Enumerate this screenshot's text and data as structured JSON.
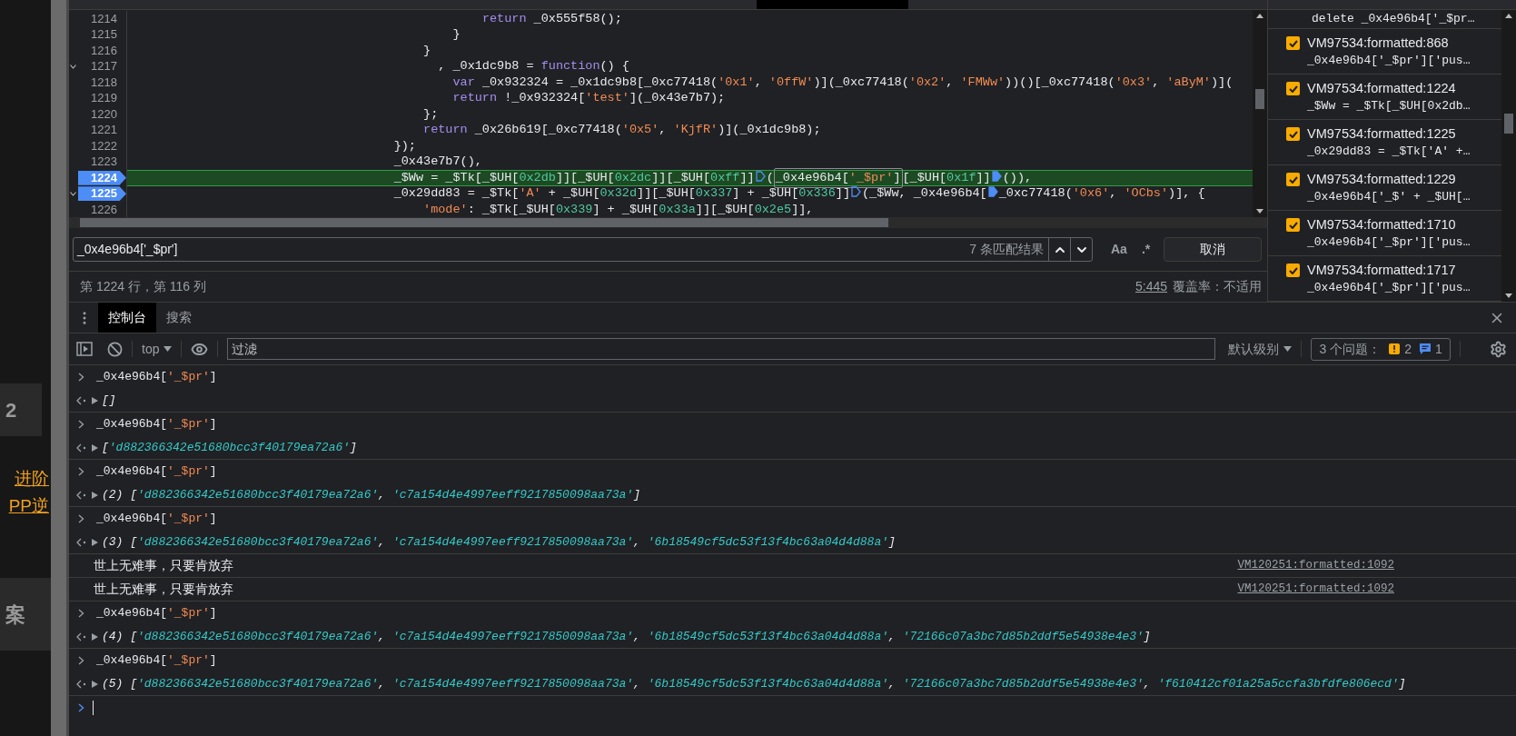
{
  "background_page": {
    "fragments": [
      {
        "text": "2",
        "kind": "tile"
      },
      {
        "text": "进阶",
        "kind": "link"
      },
      {
        "text": "PP逆",
        "kind": "link"
      },
      {
        "text": "案",
        "kind": "tile"
      }
    ]
  },
  "editor": {
    "lines": [
      {
        "number": "1214",
        "fold": false,
        "breakpoint": false,
        "current": false,
        "tokens": [
          {
            "t": "                                                return",
            "kind": "keyword"
          },
          {
            "t": " _0x555f58();",
            "kind": "plain"
          }
        ]
      },
      {
        "number": "1215",
        "fold": false,
        "breakpoint": false,
        "current": false,
        "tokens": [
          {
            "t": "                                            }",
            "kind": "plain"
          }
        ]
      },
      {
        "number": "1216",
        "fold": false,
        "breakpoint": false,
        "current": false,
        "tokens": [
          {
            "t": "                                        }",
            "kind": "plain"
          }
        ]
      },
      {
        "number": "1217",
        "fold": true,
        "breakpoint": false,
        "current": false,
        "tokens": [
          {
            "t": "                                          , _0x1dc9b8 = ",
            "kind": "plain"
          },
          {
            "t": "function",
            "kind": "keyword"
          },
          {
            "t": "() {",
            "kind": "plain"
          }
        ]
      },
      {
        "number": "1218",
        "fold": false,
        "breakpoint": false,
        "current": false,
        "tokens": [
          {
            "t": "                                            var",
            "kind": "keyword"
          },
          {
            "t": " _0x932324 = _0x1dc9b8[_0xc77418(",
            "kind": "plain"
          },
          {
            "t": "'0x1'",
            "kind": "string"
          },
          {
            "t": ", ",
            "kind": "plain"
          },
          {
            "t": "'0ffW'",
            "kind": "string"
          },
          {
            "t": ")](_0xc77418(",
            "kind": "plain"
          },
          {
            "t": "'0x2'",
            "kind": "string"
          },
          {
            "t": ", ",
            "kind": "plain"
          },
          {
            "t": "'FMWw'",
            "kind": "string"
          },
          {
            "t": "))()[_0xc77418(",
            "kind": "plain"
          },
          {
            "t": "'0x3'",
            "kind": "string"
          },
          {
            "t": ", ",
            "kind": "plain"
          },
          {
            "t": "'aByM'",
            "kind": "string"
          },
          {
            "t": ")](",
            "kind": "plain"
          }
        ]
      },
      {
        "number": "1219",
        "fold": false,
        "breakpoint": false,
        "current": false,
        "tokens": [
          {
            "t": "                                            return",
            "kind": "keyword"
          },
          {
            "t": " !_0x932324[",
            "kind": "plain"
          },
          {
            "t": "'test'",
            "kind": "string"
          },
          {
            "t": "](_0x43e7b7);",
            "kind": "plain"
          }
        ]
      },
      {
        "number": "1220",
        "fold": false,
        "breakpoint": false,
        "current": false,
        "tokens": [
          {
            "t": "                                        };",
            "kind": "plain"
          }
        ]
      },
      {
        "number": "1221",
        "fold": false,
        "breakpoint": false,
        "current": false,
        "tokens": [
          {
            "t": "                                        return",
            "kind": "keyword"
          },
          {
            "t": " _0x26b619[_0xc77418(",
            "kind": "plain"
          },
          {
            "t": "'0x5'",
            "kind": "string"
          },
          {
            "t": ", ",
            "kind": "plain"
          },
          {
            "t": "'KjfR'",
            "kind": "string"
          },
          {
            "t": ")](_0x1dc9b8);",
            "kind": "plain"
          }
        ]
      },
      {
        "number": "1222",
        "fold": false,
        "breakpoint": false,
        "current": false,
        "tokens": [
          {
            "t": "                                    });",
            "kind": "plain"
          }
        ]
      },
      {
        "number": "1223",
        "fold": false,
        "breakpoint": false,
        "current": false,
        "tokens": [
          {
            "t": "                                    _0x43e7b7(),",
            "kind": "plain"
          }
        ]
      },
      {
        "number": "1224",
        "fold": false,
        "breakpoint": true,
        "current": true,
        "tokens": [
          {
            "t": "                                    _$Ww = _$Tk[_$UH[",
            "kind": "plain"
          },
          {
            "t": "0x2db",
            "kind": "number"
          },
          {
            "t": "]][_$UH[",
            "kind": "plain"
          },
          {
            "t": "0x2dc",
            "kind": "number"
          },
          {
            "t": "]][_$UH[",
            "kind": "plain"
          },
          {
            "t": "0xff",
            "kind": "number"
          },
          {
            "t": "]]",
            "kind": "plain"
          },
          {
            "kind": "marker",
            "active": false
          },
          {
            "t": "(",
            "kind": "plain"
          },
          {
            "kind": "match",
            "parts": [
              {
                "t": "_0x4e96b4[",
                "kind": "plain"
              },
              {
                "t": "'_$pr'",
                "kind": "string"
              },
              {
                "t": "]",
                "kind": "plain"
              }
            ]
          },
          {
            "t": "[_$UH[",
            "kind": "plain"
          },
          {
            "t": "0x1f",
            "kind": "number"
          },
          {
            "t": "]]",
            "kind": "plain"
          },
          {
            "kind": "marker",
            "active": true
          },
          {
            "t": "()),",
            "kind": "plain"
          }
        ]
      },
      {
        "number": "1225",
        "fold": true,
        "breakpoint": true,
        "current": false,
        "tokens": [
          {
            "t": "                                    _0x29dd83 = _$Tk[",
            "kind": "plain"
          },
          {
            "t": "'A'",
            "kind": "string"
          },
          {
            "t": " + _$UH[",
            "kind": "plain"
          },
          {
            "t": "0x32d",
            "kind": "number"
          },
          {
            "t": "]][_$UH[",
            "kind": "plain"
          },
          {
            "t": "0x337",
            "kind": "number"
          },
          {
            "t": "] + _$UH[",
            "kind": "plain"
          },
          {
            "t": "0x336",
            "kind": "number"
          },
          {
            "t": "]]",
            "kind": "plain"
          },
          {
            "kind": "marker",
            "active": false
          },
          {
            "t": "(_$Ww, _0x4e96b4[",
            "kind": "plain"
          },
          {
            "kind": "marker",
            "active": true
          },
          {
            "t": "_0xc77418(",
            "kind": "plain"
          },
          {
            "t": "'0x6'",
            "kind": "string"
          },
          {
            "t": ", ",
            "kind": "plain"
          },
          {
            "t": "'OCbs'",
            "kind": "string"
          },
          {
            "t": ")], {",
            "kind": "plain"
          }
        ]
      },
      {
        "number": "1226",
        "fold": false,
        "breakpoint": false,
        "current": false,
        "tokens": [
          {
            "t": "                                        'mode'",
            "kind": "string"
          },
          {
            "t": ": _$Tk[_$UH[",
            "kind": "plain"
          },
          {
            "t": "0x339",
            "kind": "number"
          },
          {
            "t": "] + _$UH[",
            "kind": "plain"
          },
          {
            "t": "0x33a",
            "kind": "number"
          },
          {
            "t": "]][_$UH[",
            "kind": "plain"
          },
          {
            "t": "0x2e5",
            "kind": "number"
          },
          {
            "t": "]],",
            "kind": "plain"
          }
        ]
      }
    ]
  },
  "breakpoints": {
    "partial_code": "delete _0x4e96b4['_$pr…",
    "items": [
      {
        "location": "VM97534:formatted:868",
        "code": "_0x4e96b4['_$pr']['pus…",
        "checked": true
      },
      {
        "location": "VM97534:formatted:1224",
        "code": "_$Ww = _$Tk[_$UH[0x2db…",
        "checked": true
      },
      {
        "location": "VM97534:formatted:1225",
        "code": "_0x29dd83 = _$Tk['A' +…",
        "checked": true
      },
      {
        "location": "VM97534:formatted:1229",
        "code": "_0x4e96b4['_$' + _$UH[…",
        "checked": true
      },
      {
        "location": "VM97534:formatted:1710",
        "code": "_0x4e96b4['_$pr']['pus…",
        "checked": true
      },
      {
        "location": "VM97534:formatted:1717",
        "code": "_0x4e96b4['_$pr']['pus…",
        "checked": true
      }
    ]
  },
  "search_bar": {
    "value": "_0x4e96b4['_$pr']",
    "match_count": "7 条匹配结果",
    "case_toggle": "Aa",
    "regex_toggle": ".*",
    "cancel": "取消"
  },
  "status_bar": {
    "position": "第 1224 行，第 116 列",
    "link": "5:445",
    "coverage": "覆盖率：不适用"
  },
  "drawer": {
    "tabs": [
      {
        "label": "控制台",
        "selected": true
      },
      {
        "label": "搜索",
        "selected": false
      }
    ]
  },
  "console_toolbar": {
    "context": "top",
    "filter_placeholder": "过滤",
    "level": "默认级别",
    "issues": {
      "label": "3 个问题：",
      "warnings": "2",
      "messages": "1"
    }
  },
  "console": {
    "messages": [
      {
        "kind": "input",
        "tokens": [
          {
            "t": "_0x4e96b4[",
            "kind": "plain"
          },
          {
            "t": "'_$pr'",
            "kind": "string"
          },
          {
            "t": "]",
            "kind": "plain"
          }
        ]
      },
      {
        "kind": "result",
        "tokens": [
          {
            "t": "[]",
            "kind": "plain"
          }
        ]
      },
      {
        "kind": "input",
        "tokens": [
          {
            "t": "_0x4e96b4[",
            "kind": "plain"
          },
          {
            "t": "'_$pr'",
            "kind": "string"
          },
          {
            "t": "]",
            "kind": "plain"
          }
        ]
      },
      {
        "kind": "result",
        "tokens": [
          {
            "t": "[",
            "kind": "plain"
          },
          {
            "t": "'d882366342e51680bcc3f40179ea72a6'",
            "kind": "string"
          },
          {
            "t": "]",
            "kind": "plain"
          }
        ]
      },
      {
        "kind": "input",
        "tokens": [
          {
            "t": "_0x4e96b4[",
            "kind": "plain"
          },
          {
            "t": "'_$pr'",
            "kind": "string"
          },
          {
            "t": "]",
            "kind": "plain"
          }
        ]
      },
      {
        "kind": "result",
        "tokens": [
          {
            "t": "(2) [",
            "kind": "plain"
          },
          {
            "t": "'d882366342e51680bcc3f40179ea72a6'",
            "kind": "string"
          },
          {
            "t": ", ",
            "kind": "plain"
          },
          {
            "t": "'c7a154d4e4997eeff9217850098aa73a'",
            "kind": "string"
          },
          {
            "t": "]",
            "kind": "plain"
          }
        ]
      },
      {
        "kind": "input",
        "tokens": [
          {
            "t": "_0x4e96b4[",
            "kind": "plain"
          },
          {
            "t": "'_$pr'",
            "kind": "string"
          },
          {
            "t": "]",
            "kind": "plain"
          }
        ]
      },
      {
        "kind": "result",
        "tokens": [
          {
            "t": "(3) [",
            "kind": "plain"
          },
          {
            "t": "'d882366342e51680bcc3f40179ea72a6'",
            "kind": "string"
          },
          {
            "t": ", ",
            "kind": "plain"
          },
          {
            "t": "'c7a154d4e4997eeff9217850098aa73a'",
            "kind": "string"
          },
          {
            "t": ", ",
            "kind": "plain"
          },
          {
            "t": "'6b18549cf5dc53f13f4bc63a04d4d88a'",
            "kind": "string"
          },
          {
            "t": "]",
            "kind": "plain"
          }
        ]
      },
      {
        "kind": "log",
        "text": "世上无难事，只要肯放弃",
        "source": "VM120251:formatted:1092"
      },
      {
        "kind": "log",
        "text": "世上无难事，只要肯放弃",
        "source": "VM120251:formatted:1092"
      },
      {
        "kind": "input",
        "tokens": [
          {
            "t": "_0x4e96b4[",
            "kind": "plain"
          },
          {
            "t": "'_$pr'",
            "kind": "string"
          },
          {
            "t": "]",
            "kind": "plain"
          }
        ]
      },
      {
        "kind": "result",
        "tokens": [
          {
            "t": "(4) [",
            "kind": "plain"
          },
          {
            "t": "'d882366342e51680bcc3f40179ea72a6'",
            "kind": "string"
          },
          {
            "t": ", ",
            "kind": "plain"
          },
          {
            "t": "'c7a154d4e4997eeff9217850098aa73a'",
            "kind": "string"
          },
          {
            "t": ", ",
            "kind": "plain"
          },
          {
            "t": "'6b18549cf5dc53f13f4bc63a04d4d88a'",
            "kind": "string"
          },
          {
            "t": ", ",
            "kind": "plain"
          },
          {
            "t": "'72166c07a3bc7d85b2ddf5e54938e4e3'",
            "kind": "string"
          },
          {
            "t": "]",
            "kind": "plain"
          }
        ]
      },
      {
        "kind": "input",
        "tokens": [
          {
            "t": "_0x4e96b4[",
            "kind": "plain"
          },
          {
            "t": "'_$pr'",
            "kind": "string"
          },
          {
            "t": "]",
            "kind": "plain"
          }
        ]
      },
      {
        "kind": "result",
        "tokens": [
          {
            "t": "(5) [",
            "kind": "plain"
          },
          {
            "t": "'d882366342e51680bcc3f40179ea72a6'",
            "kind": "string"
          },
          {
            "t": ", ",
            "kind": "plain"
          },
          {
            "t": "'c7a154d4e4997eeff9217850098aa73a'",
            "kind": "string"
          },
          {
            "t": ", ",
            "kind": "plain"
          },
          {
            "t": "'6b18549cf5dc53f13f4bc63a04d4d88a'",
            "kind": "string"
          },
          {
            "t": ", ",
            "kind": "plain"
          },
          {
            "t": "'72166c07a3bc7d85b2ddf5e54938e4e3'",
            "kind": "string"
          },
          {
            "t": ", ",
            "kind": "plain"
          },
          {
            "t": "'f610412cf01a25a5ccfa3bfdfe806ecd'",
            "kind": "string"
          },
          {
            "t": "]",
            "kind": "plain"
          }
        ]
      },
      {
        "kind": "prompt"
      }
    ]
  }
}
